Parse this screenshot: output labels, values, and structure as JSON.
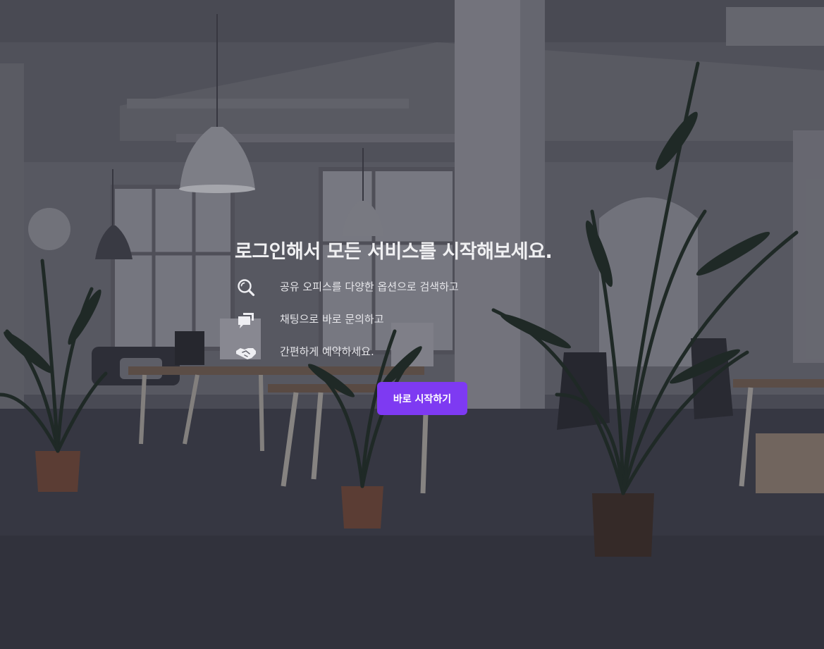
{
  "hero": {
    "title": "로그인해서 모든 서비스를 시작해보세요.",
    "features": [
      {
        "icon": "search-icon",
        "text": "공유 오피스를 다양한 옵션으로 검색하고"
      },
      {
        "icon": "chat-bubbles-icon",
        "text": "채팅으로 바로 문의하고"
      },
      {
        "icon": "handshake-icon",
        "text": "간편하게 예약하세요."
      }
    ],
    "cta_label": "바로 시작하기"
  },
  "colors": {
    "accent": "#7e3af2",
    "title_text": "#f0f0f2",
    "body_text": "#e6e6ea"
  }
}
